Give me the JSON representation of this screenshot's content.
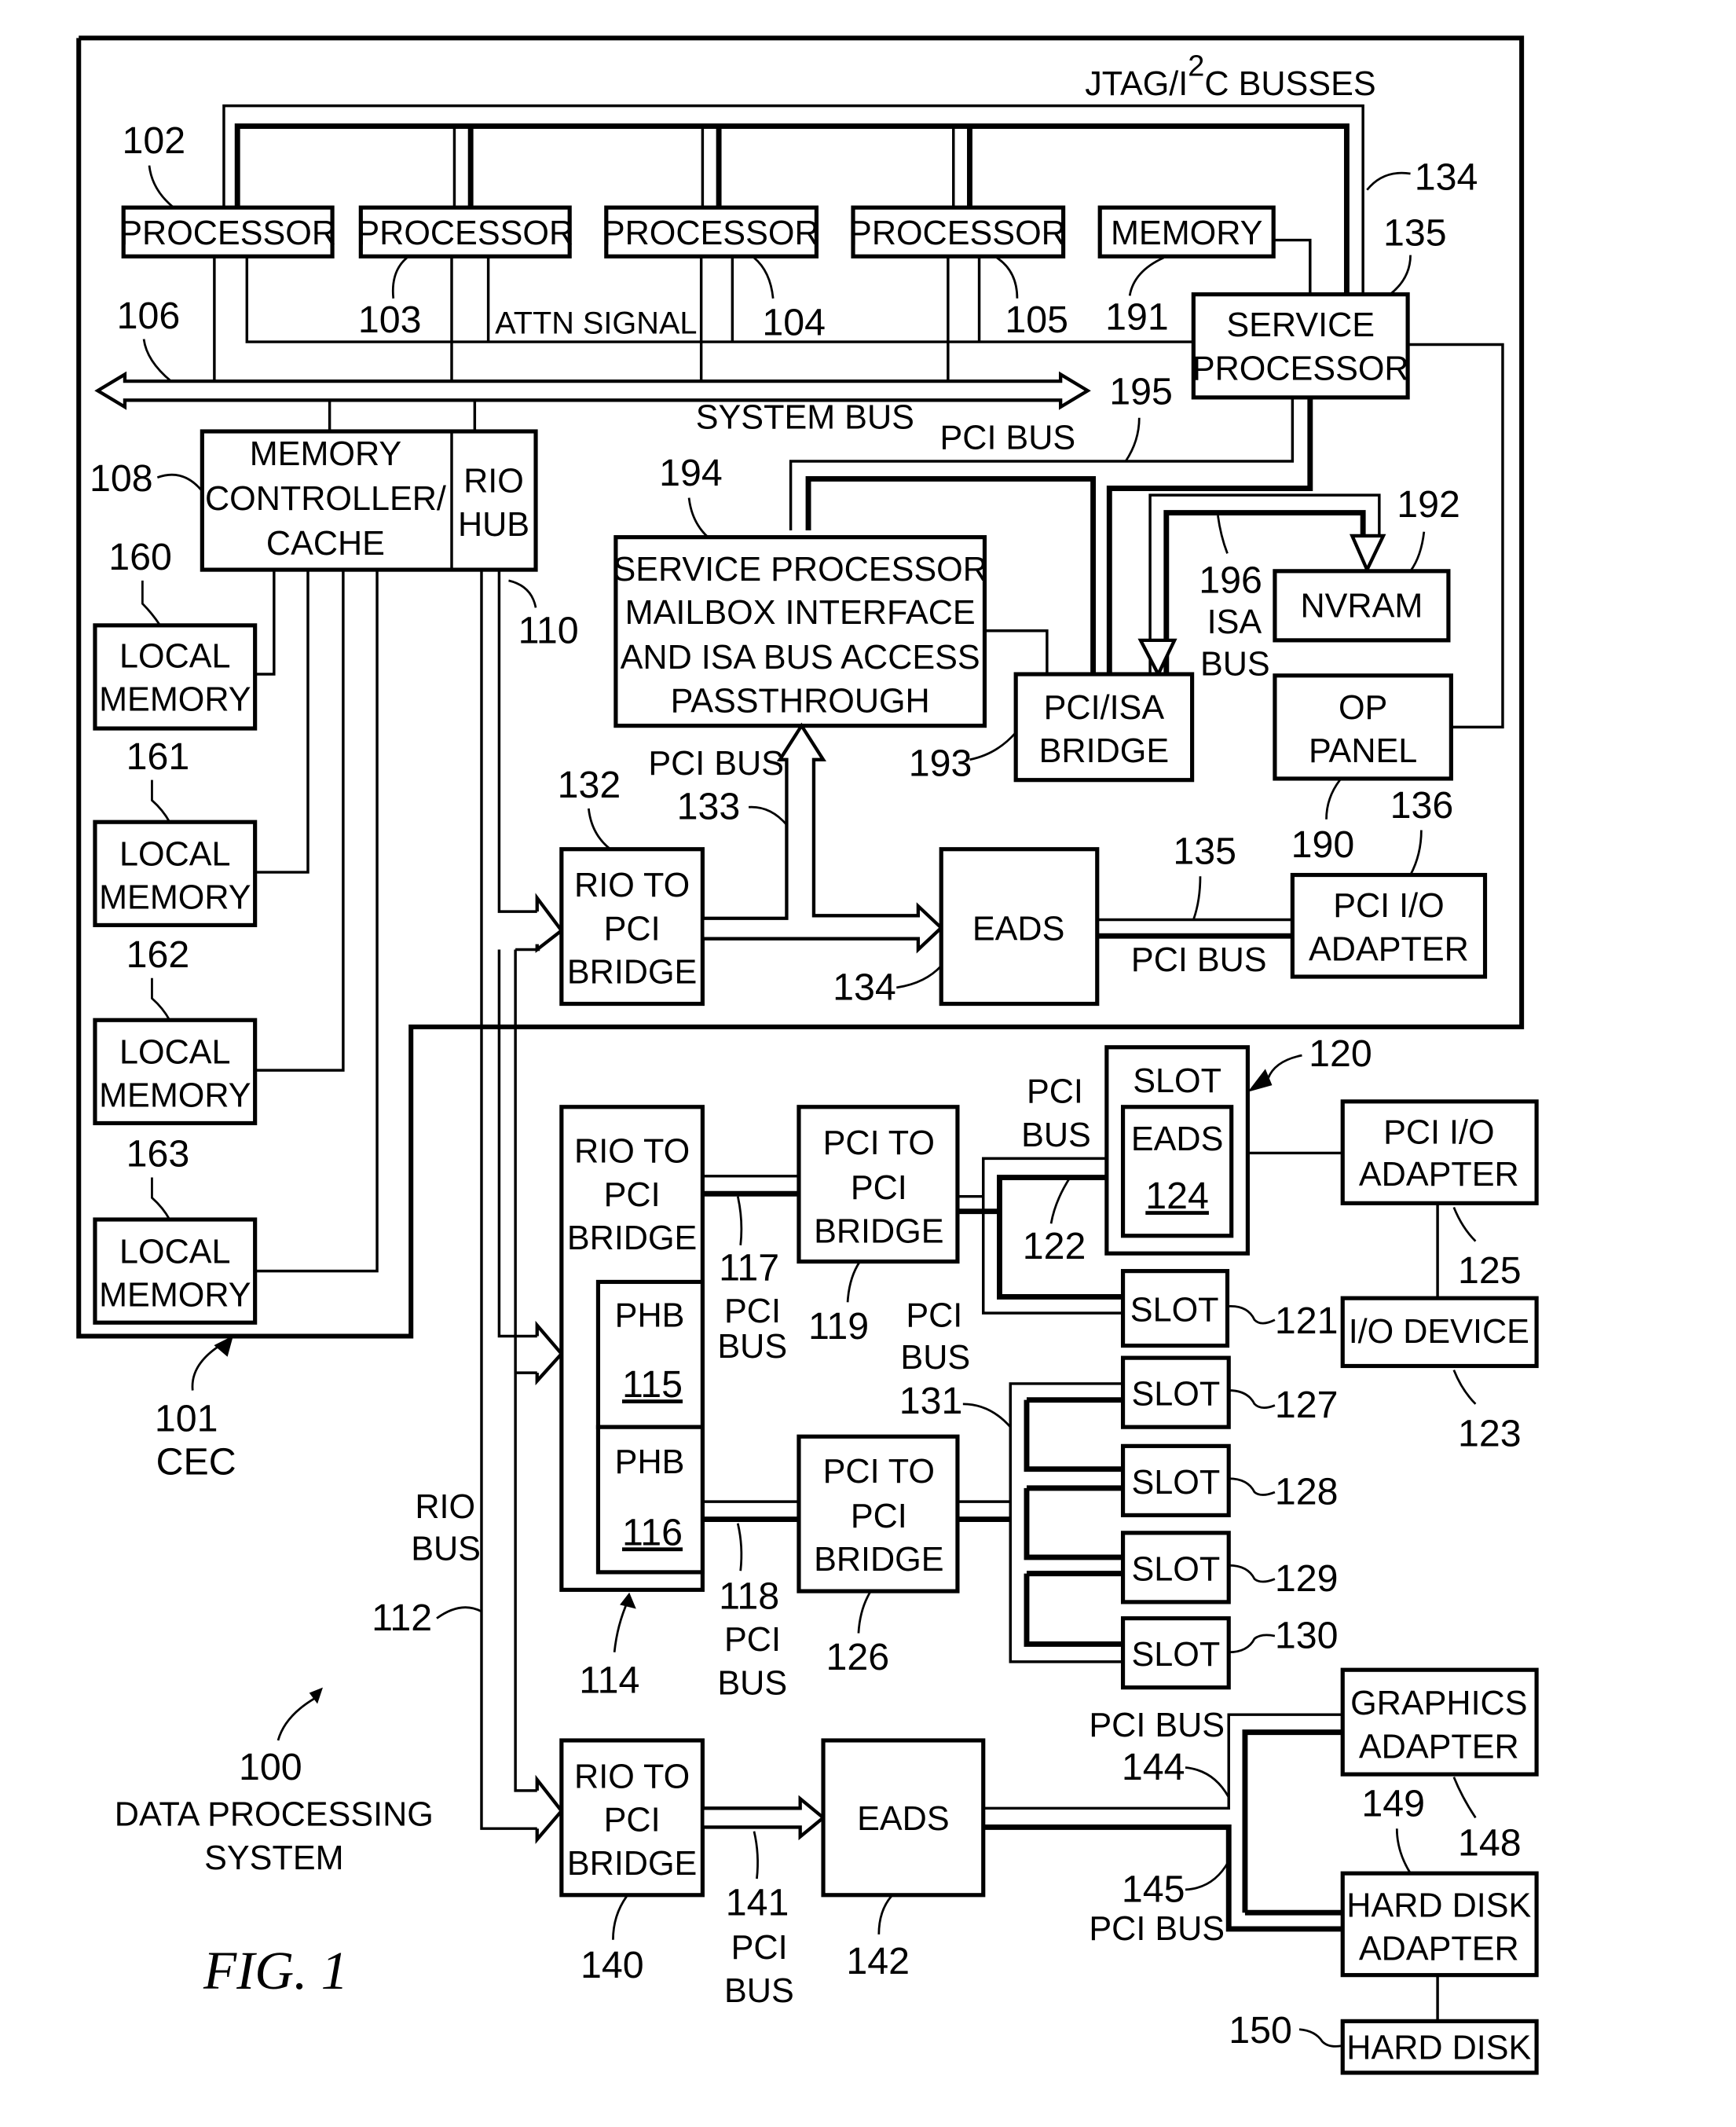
{
  "figure": {
    "caption": "FIG. 1",
    "system_label": "DATA PROCESSING SYSTEM",
    "system_label_line1": "DATA PROCESSING",
    "system_label_line2": "SYSTEM",
    "system_ref": "100",
    "cec_ref": "101",
    "cec_label": "CEC"
  },
  "buses": {
    "jtag": "JTAG/I",
    "jtag_sup": "2",
    "jtag_rest": "C BUSSES",
    "system_bus": "SYSTEM BUS",
    "attn_signal": "ATTN SIGNAL",
    "pci_bus": "PCI BUS",
    "pci": "PCI",
    "bus": "BUS",
    "isa": "ISA",
    "rio": "RIO"
  },
  "components": {
    "processor": "PROCESSOR",
    "memory": "MEMORY",
    "service_processor_1": "SERVICE",
    "service_processor_2": "PROCESSOR",
    "mem_ctrl_1": "MEMORY",
    "mem_ctrl_2": "CONTROLLER/",
    "mem_ctrl_3": "CACHE",
    "rio_hub_1": "RIO",
    "rio_hub_2": "HUB",
    "local_memory_1": "LOCAL",
    "local_memory_2": "MEMORY",
    "sp_mailbox_1": "SERVICE PROCESSOR",
    "sp_mailbox_2": "MAILBOX INTERFACE",
    "sp_mailbox_3": "AND ISA BUS ACCESS",
    "sp_mailbox_4": "PASSTHROUGH",
    "nvram": "NVRAM",
    "pci_isa_1": "PCI/ISA",
    "pci_isa_2": "BRIDGE",
    "op_panel_1": "OP",
    "op_panel_2": "PANEL",
    "rio_to_pci_1": "RIO TO",
    "rio_to_pci_2": "PCI",
    "rio_to_pci_3": "BRIDGE",
    "eads": "EADS",
    "pci_io_1": "PCI I/O",
    "pci_io_2": "ADAPTER",
    "pci_to_pci_1": "PCI TO",
    "pci_to_pci_2": "PCI",
    "pci_to_pci_3": "BRIDGE",
    "phb": "PHB",
    "slot": "SLOT",
    "io_device": "I/O DEVICE",
    "graphics_1": "GRAPHICS",
    "graphics_2": "ADAPTER",
    "hdd_adapter_1": "HARD DISK",
    "hdd_adapter_2": "ADAPTER",
    "hard_disk": "HARD DISK"
  },
  "refs": {
    "r102": "102",
    "r103": "103",
    "r104": "104",
    "r105": "105",
    "r106": "106",
    "r108": "108",
    "r110": "110",
    "r112": "112",
    "r114": "114",
    "r115": "115",
    "r116": "116",
    "r117": "117",
    "r118": "118",
    "r119": "119",
    "r120": "120",
    "r121": "121",
    "r122": "122",
    "r123": "123",
    "r124": "124",
    "r125": "125",
    "r126": "126",
    "r127": "127",
    "r128": "128",
    "r129": "129",
    "r130": "130",
    "r131": "131",
    "r132": "132",
    "r133": "133",
    "r134": "134",
    "r135": "135",
    "r136": "136",
    "r140": "140",
    "r141": "141",
    "r142": "142",
    "r144": "144",
    "r145": "145",
    "r148": "148",
    "r149": "149",
    "r150": "150",
    "r160": "160",
    "r161": "161",
    "r162": "162",
    "r163": "163",
    "r190": "190",
    "r191": "191",
    "r192": "192",
    "r193": "193",
    "r194": "194",
    "r195": "195",
    "r196": "196"
  }
}
